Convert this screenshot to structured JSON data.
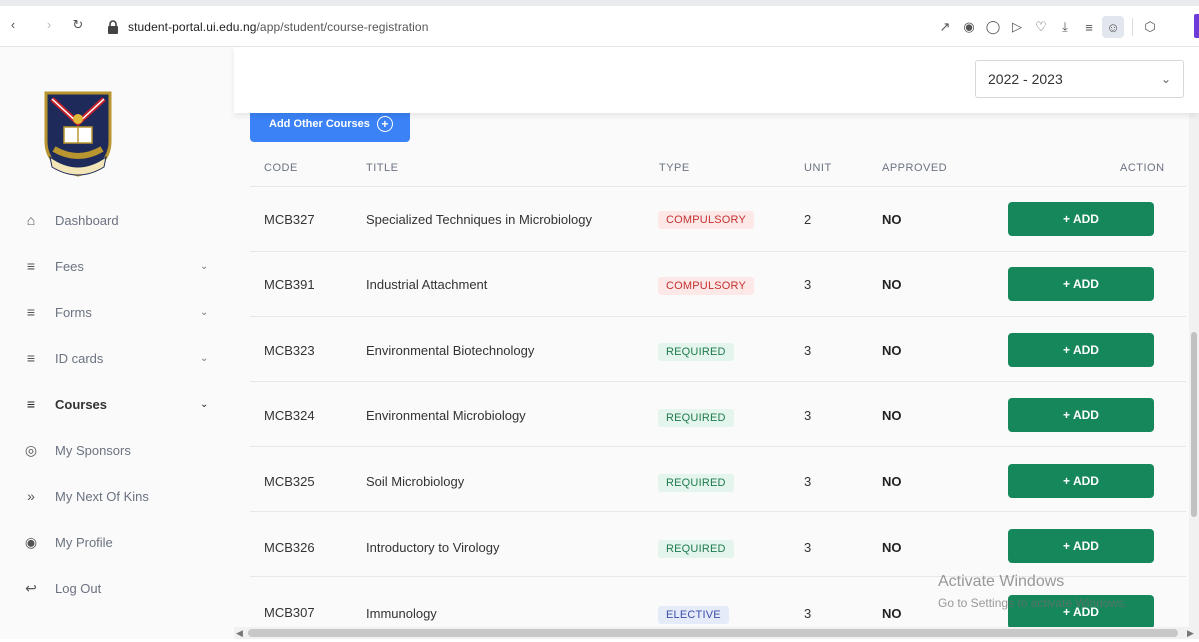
{
  "browser": {
    "url_host": "student-portal.ui.edu.ng",
    "url_path": "/app/student/course-registration",
    "nav_icons": [
      "back-icon",
      "forward-icon",
      "reload-icon"
    ],
    "toolbar_icons": [
      "share-icon",
      "camera-icon",
      "shield-icon",
      "play-icon",
      "heart-icon",
      "download-icon",
      "menu-icon",
      "profile-icon",
      "extensions-icon"
    ]
  },
  "sidebar": {
    "items": [
      {
        "label": "Dashboard",
        "icon": "home-icon",
        "expandable": false
      },
      {
        "label": "Fees",
        "icon": "list-icon",
        "expandable": true
      },
      {
        "label": "Forms",
        "icon": "list-icon",
        "expandable": true
      },
      {
        "label": "ID cards",
        "icon": "list-icon",
        "expandable": true
      },
      {
        "label": "Courses",
        "icon": "list-icon",
        "expandable": true,
        "active": true
      },
      {
        "label": "My Sponsors",
        "icon": "lifebuoy-icon",
        "expandable": false
      },
      {
        "label": "My Next Of Kins",
        "icon": "double-chevron-icon",
        "expandable": false
      },
      {
        "label": "My Profile",
        "icon": "user-circle-icon",
        "expandable": false
      },
      {
        "label": "Log Out",
        "icon": "logout-icon",
        "expandable": false
      }
    ]
  },
  "session": {
    "selected": "2022 - 2023"
  },
  "actions": {
    "add_other": "Add Other Courses"
  },
  "table": {
    "headers": {
      "code": "CODE",
      "title": "TITLE",
      "type": "TYPE",
      "unit": "UNIT",
      "approved": "APPROVED",
      "action": "ACTION"
    },
    "rows": [
      {
        "code": "MCB327",
        "title": "Specialized Techniques in Microbiology",
        "type": "COMPULSORY",
        "unit": "2",
        "approved": "NO",
        "action": "+ ADD"
      },
      {
        "code": "MCB391",
        "title": "Industrial Attachment",
        "type": "COMPULSORY",
        "unit": "3",
        "approved": "NO",
        "action": "+ ADD"
      },
      {
        "code": "MCB323",
        "title": "Environmental Biotechnology",
        "type": "REQUIRED",
        "unit": "3",
        "approved": "NO",
        "action": "+ ADD"
      },
      {
        "code": "MCB324",
        "title": "Environmental Microbiology",
        "type": "REQUIRED",
        "unit": "3",
        "approved": "NO",
        "action": "+ ADD"
      },
      {
        "code": "MCB325",
        "title": "Soil Microbiology",
        "type": "REQUIRED",
        "unit": "3",
        "approved": "NO",
        "action": "+ ADD"
      },
      {
        "code": "MCB326",
        "title": "Introductory to Virology",
        "type": "REQUIRED",
        "unit": "3",
        "approved": "NO",
        "action": "+ ADD"
      },
      {
        "code": "MCB307",
        "title": "Immunology",
        "type": "ELECTIVE",
        "unit": "3",
        "approved": "NO",
        "action": "+ ADD"
      }
    ]
  },
  "watermark": {
    "title": "Activate Windows",
    "subtitle": "Go to Settings to activate Windows."
  },
  "colors": {
    "add_button": "#16875b",
    "add_other_button": "#3b82f6",
    "compulsory": "#c53030",
    "required": "#1f7a4d",
    "elective": "#3b4fa8"
  }
}
